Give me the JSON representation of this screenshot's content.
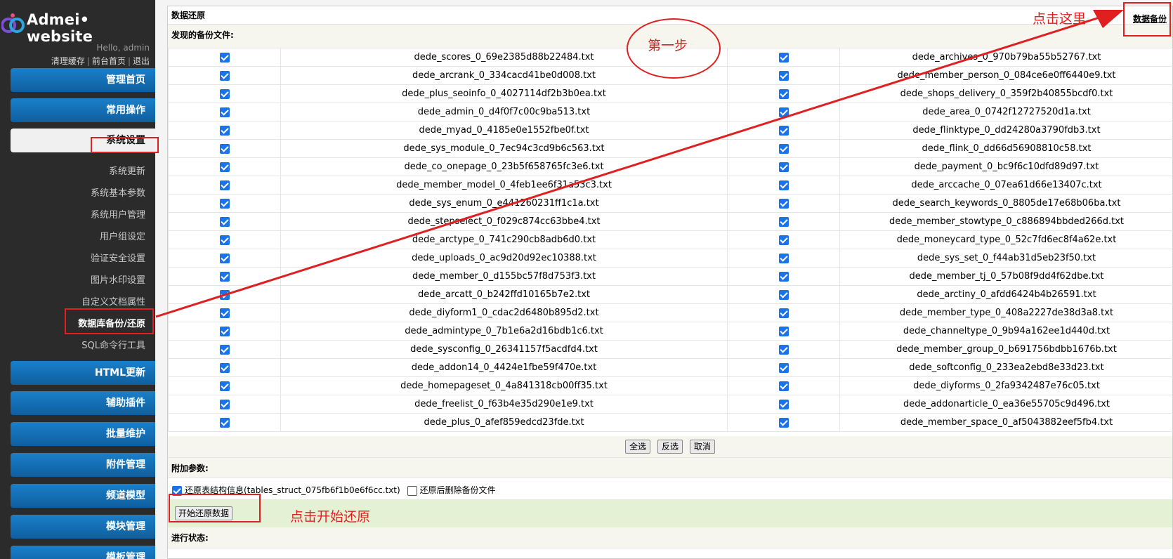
{
  "sidebar": {
    "logo_text": "Admei• website",
    "hello": "Hello, admin",
    "links": [
      "清理缓存",
      "前台首页",
      "退出"
    ],
    "nav": [
      {
        "label": "管理首页"
      },
      {
        "label": "常用操作"
      },
      {
        "label": "系统设置"
      },
      {
        "label": "HTML更新"
      },
      {
        "label": "辅助插件"
      },
      {
        "label": "批量维护"
      },
      {
        "label": "附件管理"
      },
      {
        "label": "频道模型"
      },
      {
        "label": "模块管理"
      },
      {
        "label": "模板管理"
      }
    ],
    "sub_items": [
      "系统更新",
      "系统基本参数",
      "系统用户管理",
      "用户组设定",
      "验证安全设置",
      "图片水印设置",
      "自定义文档属性",
      "数据库备份/还原",
      "SQL命令行工具"
    ]
  },
  "main": {
    "title": "数据还原",
    "backup_link": "数据备份",
    "found_label": "发现的备份文件:",
    "files": [
      [
        "dede_scores_0_69e2385d88b22484.txt",
        "dede_archives_0_970b79ba55b52767.txt"
      ],
      [
        "dede_arcrank_0_334cacd41be0d008.txt",
        "dede_member_person_0_084ce6e0ff6440e9.txt"
      ],
      [
        "dede_plus_seoinfo_0_4027114df2b3b0ea.txt",
        "dede_shops_delivery_0_359f2b40855bcdf0.txt"
      ],
      [
        "dede_admin_0_d4f0f7c00c9ba513.txt",
        "dede_area_0_0742f12727520d1a.txt"
      ],
      [
        "dede_myad_0_4185e0e1552fbe0f.txt",
        "dede_flinktype_0_dd24280a3790fdb3.txt"
      ],
      [
        "dede_sys_module_0_7ec94c3cd9b6c563.txt",
        "dede_flink_0_dd66d56908810c58.txt"
      ],
      [
        "dede_co_onepage_0_23b5f658765fc3e6.txt",
        "dede_payment_0_bc9f6c10dfd89d97.txt"
      ],
      [
        "dede_member_model_0_4feb1ee6f31a53c3.txt",
        "dede_arccache_0_07ea61d66e13407c.txt"
      ],
      [
        "dede_sys_enum_0_e441260231ff1c1a.txt",
        "dede_search_keywords_0_8805de17e68b06ba.txt"
      ],
      [
        "dede_stepselect_0_f029c874cc63bbe4.txt",
        "dede_member_stowtype_0_c886894bbded266d.txt"
      ],
      [
        "dede_arctype_0_741c290cb8adb6d0.txt",
        "dede_moneycard_type_0_52c7fd6ec8f4a62e.txt"
      ],
      [
        "dede_uploads_0_ac9d20d92ec10388.txt",
        "dede_sys_set_0_f44ab31d5eb23f50.txt"
      ],
      [
        "dede_member_0_d155bc57f8d753f3.txt",
        "dede_member_tj_0_57b08f9dd4f62dbe.txt"
      ],
      [
        "dede_arcatt_0_b242ffd10165b7e2.txt",
        "dede_arctiny_0_afdd6424b4b26591.txt"
      ],
      [
        "dede_diyform1_0_cdac2d6480b895d2.txt",
        "dede_member_type_0_408a2227de38d3a8.txt"
      ],
      [
        "dede_admintype_0_7b1e6a2d16bdb1c6.txt",
        "dede_channeltype_0_9b94a162ee1d440d.txt"
      ],
      [
        "dede_sysconfig_0_26341157f5acdfd4.txt",
        "dede_member_group_0_b691756bdbb1676b.txt"
      ],
      [
        "dede_addon14_0_4424e1fbe59f470e.txt",
        "dede_softconfig_0_233ea2ebd8e33d23.txt"
      ],
      [
        "dede_homepageset_0_4a841318cb00ff35.txt",
        "dede_diyforms_0_2fa9342487e76c05.txt"
      ],
      [
        "dede_freelist_0_f63b4e35d290e1e9.txt",
        "dede_addonarticle_0_ea36e55705c9d496.txt"
      ],
      [
        "dede_plus_0_afef859edcd23fde.txt",
        "dede_member_space_0_af5043882eef5fb4.txt"
      ]
    ],
    "buttons": {
      "select_all": "全选",
      "invert": "反选",
      "cancel": "取消"
    },
    "params_label": "附加参数:",
    "opt_struct": "还原表结构信息(tables_struct_075fb6f1b0e6f6cc.txt)",
    "opt_struct_checked": true,
    "opt_delete": "还原后删除备份文件",
    "opt_delete_checked": false,
    "start_button": "开始还原数据",
    "status_label": "进行状态:"
  },
  "annotations": {
    "step1": "第一步",
    "click_here": "点击这里",
    "click_start": "点击开始还原",
    "color": "#e02020"
  }
}
